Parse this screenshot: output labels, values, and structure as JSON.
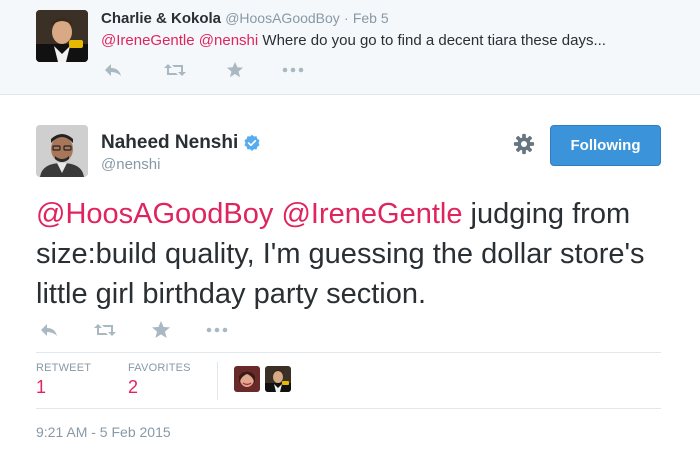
{
  "parent_tweet": {
    "name": "Charlie & Kokola",
    "handle": "@HoosAGoodBoy",
    "separator": "·",
    "time": "Feb 5",
    "mention1": "@IreneGentle",
    "mention2": "@nenshi",
    "text": "Where do you go to find a decent tiara these days..."
  },
  "main_tweet": {
    "name": "Naheed Nenshi",
    "handle": "@nenshi",
    "follow_label": "Following",
    "mention1": "@HoosAGoodBoy",
    "mention2": "@IreneGentle",
    "text": "judging from size:build quality, I'm guessing the dollar store's little girl birthday party section.",
    "retweet_label": "RETWEET",
    "retweet_count": "1",
    "favorites_label": "FAVORITES",
    "favorites_count": "2",
    "timestamp": "9:21 AM - 5 Feb 2015"
  },
  "colors": {
    "mention": "#e0245e",
    "follow_button": "#3b94d9",
    "muted": "#8899a6",
    "verified": "#55acee"
  },
  "icons": [
    "reply-icon",
    "retweet-icon",
    "favorite-star-icon",
    "more-options-icon",
    "gear-icon",
    "verified-badge-icon"
  ]
}
